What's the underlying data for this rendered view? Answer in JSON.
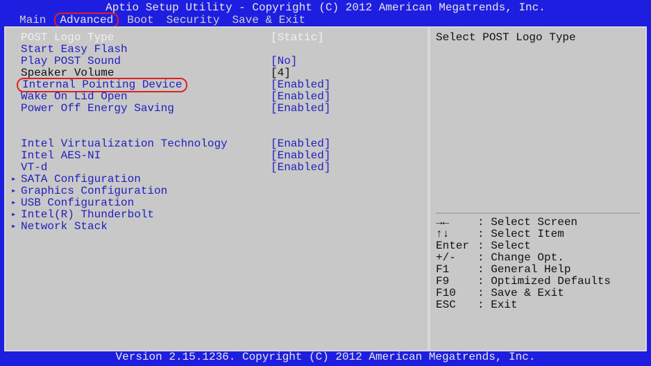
{
  "header": {
    "title": "Aptio Setup Utility - Copyright (C) 2012 American Megatrends, Inc.",
    "menu": [
      "Main",
      "Advanced",
      "Boot",
      "Security",
      "Save & Exit"
    ],
    "active_menu_index": 1
  },
  "settings": {
    "selected_index": 0,
    "items": [
      {
        "label": "POST Logo Type",
        "value": "[Static]",
        "style": "white",
        "type": "option"
      },
      {
        "label": "Start Easy Flash",
        "value": "",
        "style": "blue",
        "type": "action"
      },
      {
        "label": "Play POST Sound",
        "value": "[No]",
        "style": "blue",
        "type": "option"
      },
      {
        "label": "Speaker Volume",
        "value": "[4]",
        "style": "black",
        "type": "option"
      },
      {
        "label": "Internal Pointing Device",
        "value": "[Enabled]",
        "style": "blue",
        "type": "option",
        "highlighted": true
      },
      {
        "label": "Wake On Lid Open",
        "value": "[Enabled]",
        "style": "blue",
        "type": "option"
      },
      {
        "label": "Power Off Energy Saving",
        "value": "[Enabled]",
        "style": "blue",
        "type": "option"
      }
    ],
    "group2": [
      {
        "label": "Intel Virtualization Technology",
        "value": "[Enabled]",
        "style": "blue",
        "type": "option"
      },
      {
        "label": "Intel AES-NI",
        "value": "[Enabled]",
        "style": "blue",
        "type": "option"
      },
      {
        "label": "VT-d",
        "value": "[Enabled]",
        "style": "blue",
        "type": "option"
      }
    ],
    "submenus": [
      {
        "label": "SATA Configuration"
      },
      {
        "label": "Graphics Configuration"
      },
      {
        "label": "USB Configuration"
      },
      {
        "label": "Intel(R) Thunderbolt"
      },
      {
        "label": "Network Stack"
      }
    ]
  },
  "help": {
    "description": "Select POST Logo Type",
    "keys": [
      {
        "key": "→←",
        "desc": ": Select Screen"
      },
      {
        "key": "↑↓",
        "desc": ": Select Item"
      },
      {
        "key": "Enter",
        "desc": ": Select"
      },
      {
        "key": "+/-",
        "desc": ": Change Opt."
      },
      {
        "key": "F1",
        "desc": ": General Help"
      },
      {
        "key": "F9",
        "desc": ": Optimized Defaults"
      },
      {
        "key": "F10",
        "desc": ": Save & Exit"
      },
      {
        "key": "ESC",
        "desc": ": Exit"
      }
    ]
  },
  "footer": {
    "version": "Version 2.15.1236. Copyright (C) 2012 American Megatrends, Inc."
  },
  "annotations": {
    "circled_menu": "Advanced",
    "circled_item": "Internal Pointing Device"
  }
}
